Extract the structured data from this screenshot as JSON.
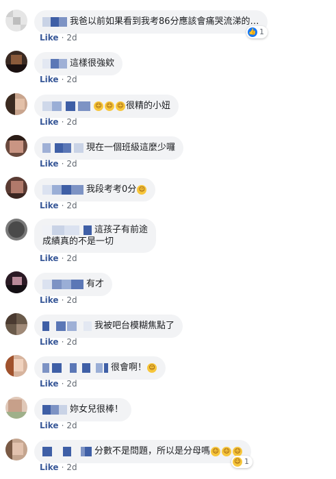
{
  "like_label": "Like",
  "dot": "·",
  "comments": [
    {
      "text": "我爸以前如果看到我考86分應該會痛哭流涕的…",
      "time": "2d",
      "reaction": {
        "type": "like",
        "count": "1"
      }
    },
    {
      "text": "這樣很強欸",
      "time": "2d"
    },
    {
      "text": "很精的小妞",
      "emoji_prefix": 3,
      "time": "2d"
    },
    {
      "text": "現在一個班級這麼少囉",
      "time": "2d"
    },
    {
      "text": "我段考考0分",
      "emoji_suffix": 1,
      "time": "2d"
    },
    {
      "text_line1": "這孩子有前途",
      "text_line2": "成績真的不是一切",
      "time": "2d"
    },
    {
      "text": "有才",
      "time": "2d"
    },
    {
      "text": "我被吧台模糊焦點了",
      "time": "2d"
    },
    {
      "text": "很會啊！",
      "emoji_suffix": 1,
      "time": "2d"
    },
    {
      "text": "妳女兒很棒！",
      "time": "2d"
    },
    {
      "text": "分數不是問題，所以是分母嗎",
      "emoji_suffix": 3,
      "time": "2d",
      "reaction": {
        "type": "haha",
        "count": "1"
      }
    }
  ],
  "colors": {
    "like_link": "#385898",
    "bubble": "#f2f3f5",
    "meta": "#606770",
    "emoji": "#f7c63b",
    "like_badge": "#1877f2"
  },
  "icons": {
    "like": "thumbs-up-icon",
    "haha": "laughing-emoji-icon"
  }
}
